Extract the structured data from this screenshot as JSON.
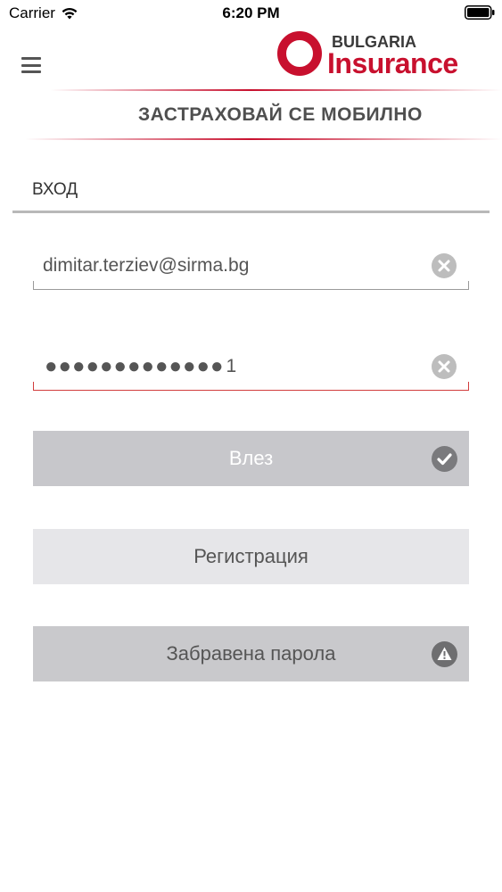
{
  "status_bar": {
    "carrier": "Carrier",
    "time": "6:20 PM",
    "wifi_icon": "wifi-icon",
    "battery_icon": "battery-icon"
  },
  "header": {
    "menu_icon": "hamburger-menu-icon",
    "logo_top": "BULGARIA",
    "logo_bottom": "Insurance",
    "slogan": "ЗАСТРАХОВАЙ СЕ МОБИЛНО"
  },
  "login": {
    "title": "ВХОД",
    "email": {
      "value": "dimitar.terziev@sirma.bg",
      "clear_icon": "clear-circle-icon"
    },
    "password": {
      "masked": "●●●●●●●●●●●●●",
      "last_char": "1",
      "clear_icon": "clear-circle-icon"
    },
    "login_button": {
      "label": "Влез",
      "icon": "checkmark-circle-icon"
    },
    "register_button": {
      "label": "Регистрация"
    },
    "forgot_button": {
      "label": "Забравена парола",
      "icon": "warning-circle-icon"
    }
  },
  "colors": {
    "brand_red": "#c8102e",
    "error_red": "#d23d3d",
    "button_gray": "#c7c7cb",
    "button_light": "#e6e6e9"
  }
}
